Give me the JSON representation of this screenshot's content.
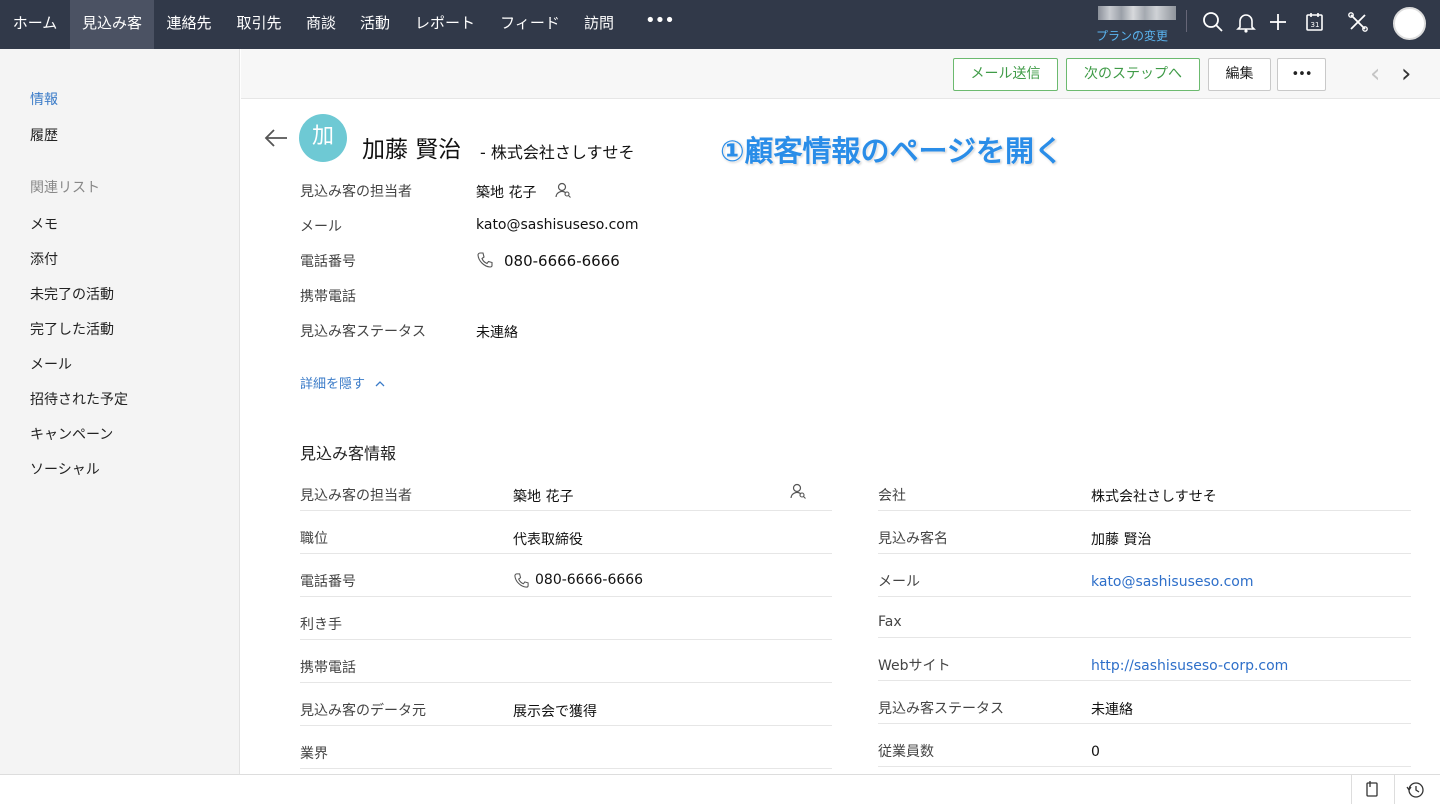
{
  "nav": {
    "items": [
      "ホーム",
      "見込み客",
      "連絡先",
      "取引先",
      "商談",
      "活動",
      "レポート",
      "フィード",
      "訪問"
    ],
    "active_index": 1,
    "more": "•••",
    "plan_change": "プランの変更"
  },
  "sidebar": {
    "info": "情報",
    "history": "履歴",
    "related_head": "関連リスト",
    "related": [
      "メモ",
      "添付",
      "未完了の活動",
      "完了した活動",
      "メール",
      "招待された予定",
      "キャンペーン",
      "ソーシャル"
    ]
  },
  "actions": {
    "send_mail": "メール送信",
    "next_step": "次のステップへ",
    "edit": "編集",
    "more": "•••"
  },
  "record": {
    "avatar_char": "加",
    "name": "加藤 賢治",
    "company_suffix": "- 株式会社さしすせそ",
    "annotation": "①顧客情報のページを開く"
  },
  "summary": {
    "owner_label": "見込み客の担当者",
    "owner_value": "築地 花子",
    "email_label": "メール",
    "email_value": "kato@sashisuseso.com",
    "phone_label": "電話番号",
    "phone_value": "080-6666-6666",
    "mobile_label": "携帯電話",
    "status_label": "見込み客ステータス",
    "status_value": "未連絡",
    "hide_details": "詳細を隠す"
  },
  "section": {
    "title": "見込み客情報",
    "left": [
      {
        "label": "見込み客の担当者",
        "value": "築地 花子"
      },
      {
        "label": "職位",
        "value": "代表取締役"
      },
      {
        "label": "電話番号",
        "value": "080-6666-6666"
      },
      {
        "label": "利き手",
        "value": ""
      },
      {
        "label": "携帯電話",
        "value": ""
      },
      {
        "label": "見込み客のデータ元",
        "value": "展示会で獲得"
      },
      {
        "label": "業界",
        "value": ""
      }
    ],
    "right": [
      {
        "label": "会社",
        "value": "株式会社さしすせそ"
      },
      {
        "label": "見込み客名",
        "value": "加藤 賢治"
      },
      {
        "label": "メール",
        "value": "kato@sashisuseso.com"
      },
      {
        "label": "Fax",
        "value": ""
      },
      {
        "label": "Webサイト",
        "value": "http://sashisuseso-corp.com"
      },
      {
        "label": "見込み客ステータス",
        "value": "未連絡"
      },
      {
        "label": "従業員数",
        "value": "0"
      }
    ]
  },
  "colors": {
    "topbar": "#313949",
    "accent_green": "#3f9b47",
    "link_blue": "#2e6fc9",
    "annotation_blue": "#2a8de8"
  }
}
